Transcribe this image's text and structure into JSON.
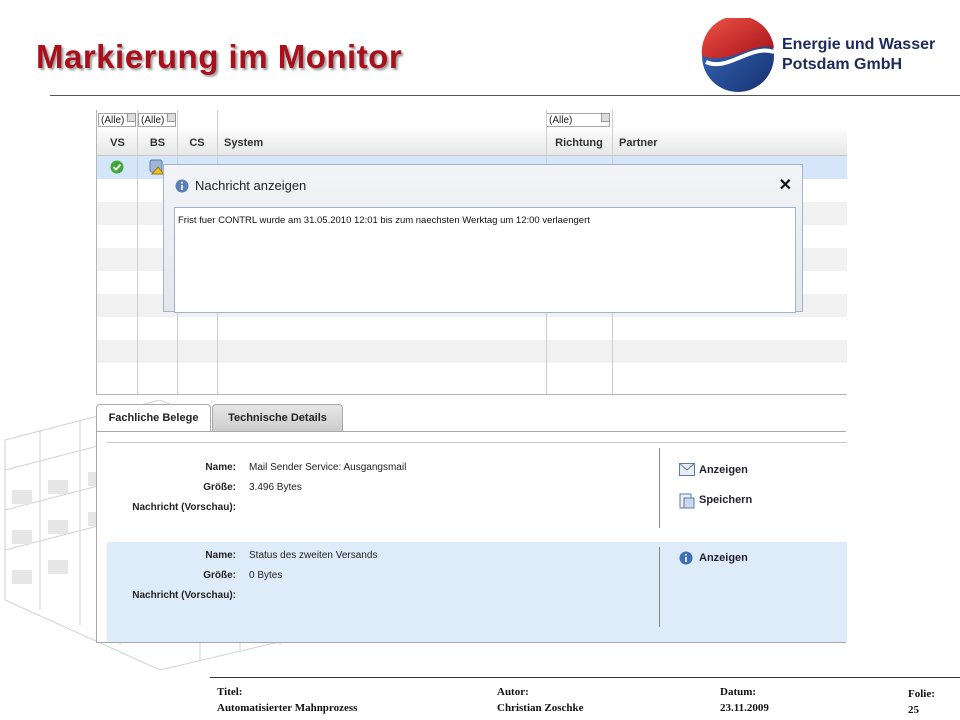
{
  "slide": {
    "title": "Markierung im Monitor",
    "company_line1": "Energie und Wasser",
    "company_line2": "Potsdam GmbH"
  },
  "grid": {
    "filters": [
      "(Alle)",
      "(Alle)",
      "(Alle)"
    ],
    "headers": [
      "VS",
      "BS",
      "CS",
      "System",
      "Richtung",
      "Partner"
    ]
  },
  "dialog": {
    "title": "Nachricht anzeigen",
    "message": "Frist fuer CONTRL wurde am 31.05.2010 12:01 bis zum naechsten Werktag um 12:00 verlaengert"
  },
  "tabs": [
    "Fachliche Belege",
    "Technische Details"
  ],
  "details": {
    "panel1": {
      "name_label": "Name:",
      "name_value": "Mail Sender Service: Ausgangsmail",
      "size_label": "Größe:",
      "size_value": "3.496 Bytes",
      "preview_label": "Nachricht (Vorschau):",
      "action1": "Anzeigen",
      "action2": "Speichern"
    },
    "panel2": {
      "name_label": "Name:",
      "name_value": "Status des zweiten Versands",
      "size_label": "Größe:",
      "size_value": "0 Bytes",
      "preview_label": "Nachricht (Vorschau):",
      "action1": "Anzeigen"
    }
  },
  "footer": {
    "title_label": "Titel:",
    "title_value": "Automatisierter Mahnprozess",
    "author_label": "Autor:",
    "author_value": "Christian Zoschke",
    "date_label": "Datum:",
    "date_value": "23.11.2009",
    "slide_label": "Folie:",
    "slide_value": "25"
  },
  "colors": {
    "title_red": "#a8111b",
    "selection_blue": "#d5e6fa",
    "panel_blue": "#deecf9"
  },
  "icons": [
    "check-icon",
    "warning-icon",
    "info-icon",
    "close-icon",
    "mail-icon",
    "save-icon"
  ]
}
